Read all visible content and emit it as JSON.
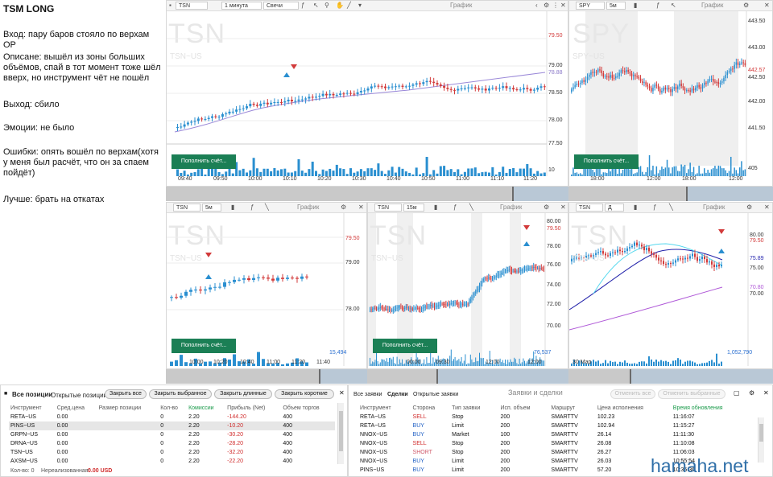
{
  "notes": {
    "title": "TSM LONG",
    "entry": "Вход: пару баров стояло по верхам ОР",
    "description": "Описане: вышёл из зоны больших объёмов, спай в тот момент тоже шёл вверх, но инструмент чёт не пошёл",
    "exit": "Выход: сбило",
    "emotions": "Эмоции: не было",
    "errors": "Ошибки: опять вошёл по верхам(хотя у меня был расчёт, что он за спаем пойдёт)",
    "better": "Лучше: брать на откатах"
  },
  "charts": {
    "top_left": {
      "symbol": "TSN",
      "interval": "1 минута",
      "type": "Свечи",
      "tab": "График",
      "watermark": "TSN",
      "watermark_sub": "TSN~US",
      "price_ticks": [
        "79.50",
        "79.00",
        "78.88",
        "78.50",
        "78.00",
        "77.50"
      ],
      "time_ticks": [
        "09:40",
        "09:50",
        "10:00",
        "10:10",
        "10:20",
        "10:30",
        "10:40",
        "10:50",
        "11:00",
        "11:10",
        "11:20"
      ],
      "cur_price": "79.50",
      "ma_price": "78.88",
      "vol_label": "10",
      "deposit": "Пополнить счёт..."
    },
    "top_right": {
      "symbol": "SPY",
      "interval": "5м",
      "tab": "График",
      "watermark": "SPY",
      "watermark_sub": "SPY~US",
      "price_ticks": [
        "443.50",
        "443.00",
        "442.57",
        "442.50",
        "442.00",
        "441.50"
      ],
      "cur_price": "442.57",
      "vol_label": "405",
      "time_ticks": [
        "18:00",
        "12:00",
        "18:00",
        "12:00"
      ],
      "deposit": "Пополнить счёт..."
    },
    "mid_left": {
      "symbol": "TSN",
      "interval": "5м",
      "tab": "График",
      "watermark": "TSN",
      "watermark_sub": "TSN~US",
      "price_ticks": [
        "79.50",
        "79.00",
        "78.00"
      ],
      "cur_price": "79.50",
      "vol_label": "15,494",
      "time_ticks": [
        "10:00",
        "10:20",
        "10:40",
        "11:00",
        "11:20",
        "11:40"
      ],
      "deposit": "Пополнить счёт..."
    },
    "mid_center": {
      "symbol": "TSN",
      "interval": "15м",
      "tab": "График",
      "watermark": "TSN",
      "watermark_sub": "TSN~US",
      "price_ticks": [
        "80.00",
        "79.50",
        "78.00",
        "76.00",
        "74.00",
        "72.00",
        "70.00"
      ],
      "cur_price": "79.50",
      "vol_label": "76,537",
      "time_ticks": [
        "00:00",
        "09:30",
        "12:00",
        "12:00"
      ],
      "deposit": "Пополнить счёт..."
    },
    "mid_right": {
      "symbol": "TSN",
      "interval": "Д",
      "tab": "График",
      "watermark": "TSN",
      "watermark_sub": "TSN~US",
      "price_ticks": [
        "80.00",
        "75.89",
        "75.00",
        "70.80",
        "70.00"
      ],
      "price_tag_top": "79.50",
      "price_tag_blue": "75.89",
      "price_tag_purple": "70.80",
      "vol_label": "1,052,790",
      "time_ticks": [
        "30 Мар"
      ],
      "deposit": "Пополнить счёт..."
    }
  },
  "positions": {
    "tabs": [
      "Все позиции",
      "Открытые позиции"
    ],
    "buttons": [
      "Закрыть все",
      "Закрыть выбранное",
      "Закрыть длинные",
      "Закрыть короткие"
    ],
    "columns": [
      "Инструмент",
      "Сред.цена",
      "Размер позиции",
      "Кол-во",
      "Комиссии",
      "Прибыль (Net)",
      "Объем торгов"
    ],
    "rows": [
      {
        "sym": "RETA~US",
        "avg": "0.00",
        "size": "",
        "qty": "0",
        "comm": "2.20",
        "pnl": "-144.20",
        "vol": "400"
      },
      {
        "sym": "PINS~US",
        "avg": "0.00",
        "size": "",
        "qty": "0",
        "comm": "2.20",
        "pnl": "-10.20",
        "vol": "400"
      },
      {
        "sym": "GRPN~US",
        "avg": "0.00",
        "size": "",
        "qty": "0",
        "comm": "2.20",
        "pnl": "-30.20",
        "vol": "400"
      },
      {
        "sym": "DRNA~US",
        "avg": "0.00",
        "size": "",
        "qty": "0",
        "comm": "2.20",
        "pnl": "-28.20",
        "vol": "400"
      },
      {
        "sym": "TSN~US",
        "avg": "0.00",
        "size": "",
        "qty": "0",
        "comm": "2.20",
        "pnl": "-32.20",
        "vol": "400"
      },
      {
        "sym": "AXSM~US",
        "avg": "0.00",
        "size": "",
        "qty": "0",
        "comm": "2.20",
        "pnl": "-22.20",
        "vol": "400"
      }
    ],
    "footer_qty": "Кол-во: 0",
    "footer_unreal_label": "Нереализованная:",
    "footer_unreal_value": "0.00 USD"
  },
  "orders": {
    "tabs": [
      "Все заявки",
      "Сделки",
      "Открытые заявки"
    ],
    "header_title": "Заявки и сделки",
    "btn_cancel_all": "Отменить все",
    "btn_cancel_sel": "Отменить выбранные",
    "columns": [
      "Инструмент",
      "Сторона",
      "Тип заявки",
      "Исп. объем",
      "Маршрут",
      "Цена исполнения",
      "Время обновления"
    ],
    "rows": [
      {
        "sym": "RETA~US",
        "side": "SELL",
        "type": "Stop",
        "qty": "200",
        "route": "SMARTTV",
        "price": "102.23",
        "time": "11:16:07"
      },
      {
        "sym": "RETA~US",
        "side": "BUY",
        "type": "Limit",
        "qty": "200",
        "route": "SMARTTV",
        "price": "102.94",
        "time": "11:15:27"
      },
      {
        "sym": "NNOX~US",
        "side": "BUY",
        "type": "Market",
        "qty": "100",
        "route": "SMARTTV",
        "price": "26.14",
        "time": "11:11:30"
      },
      {
        "sym": "NNOX~US",
        "side": "SELL",
        "type": "Stop",
        "qty": "200",
        "route": "SMARTTV",
        "price": "26.08",
        "time": "11:10:08"
      },
      {
        "sym": "NNOX~US",
        "side": "SHORT",
        "type": "Stop",
        "qty": "200",
        "route": "SMARTTV",
        "price": "26.27",
        "time": "11:06:03"
      },
      {
        "sym": "NNOX~US",
        "side": "BUY",
        "type": "Limit",
        "qty": "200",
        "route": "SMARTTV",
        "price": "26.03",
        "time": "10:55:54"
      },
      {
        "sym": "PINS~US",
        "side": "BUY",
        "type": "Limit",
        "qty": "200",
        "route": "SMARTTV",
        "price": "57.20",
        "time": "10:35:36"
      }
    ]
  },
  "watermark_site": "hamaha.net",
  "colors": {
    "up": "#2a8fd0",
    "down": "#d23a3a",
    "ma": "#9a88d8",
    "green_btn": "#1b7f55",
    "accent": "#2b6fd6"
  }
}
